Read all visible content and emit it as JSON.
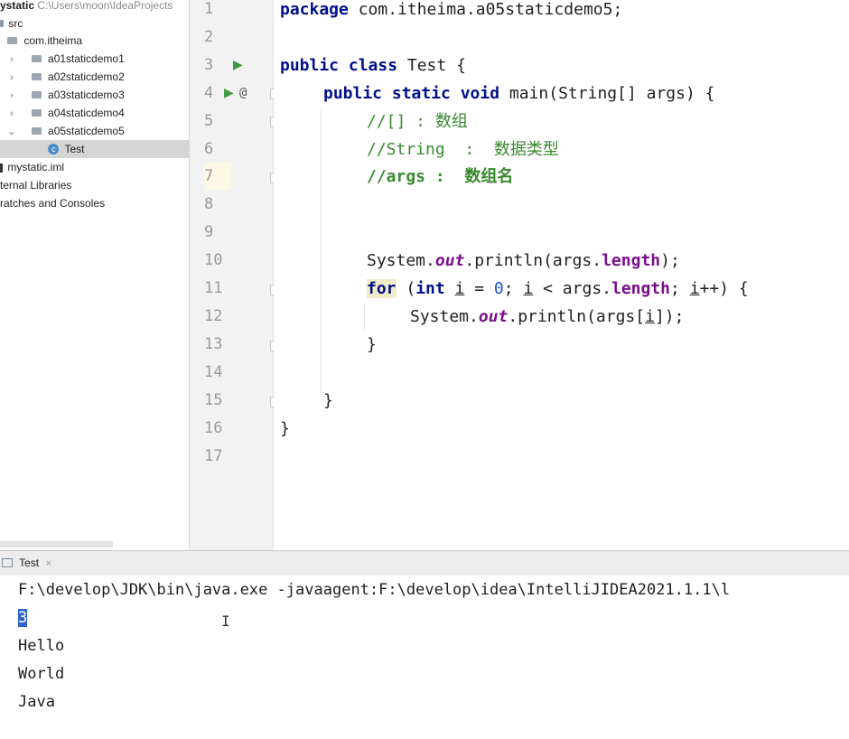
{
  "project_tree": {
    "root_label": "ystatic",
    "root_path": "C:\\Users\\moon\\IdeaProjects",
    "items": [
      {
        "label": "src",
        "icon": "folder-icon"
      },
      {
        "label": "com.itheima",
        "icon": "package-folder-icon"
      },
      {
        "label": "a01staticdemo1",
        "icon": "package-folder-icon"
      },
      {
        "label": "a02staticdemo2",
        "icon": "package-folder-icon"
      },
      {
        "label": "a03staticdemo3",
        "icon": "package-folder-icon"
      },
      {
        "label": "a04staticdemo4",
        "icon": "package-folder-icon"
      },
      {
        "label": "a05staticdemo5",
        "icon": "package-folder-icon"
      },
      {
        "label": "Test",
        "icon": "class-icon"
      },
      {
        "label": "mystatic.iml",
        "icon": "module-file-icon"
      },
      {
        "label": "ternal Libraries",
        "icon": "library-icon"
      },
      {
        "label": "ratches and Consoles",
        "icon": "scratch-icon"
      }
    ]
  },
  "editor": {
    "line_numbers": [
      "1",
      "2",
      "3",
      "4",
      "5",
      "6",
      "7",
      "8",
      "9",
      "10",
      "11",
      "12",
      "13",
      "14",
      "15",
      "16",
      "17"
    ],
    "lines": {
      "l1_kw": "package",
      "l1_rest": " com.itheima.a05staticdemo5;",
      "l3_kw": "public class",
      "l3_rest": " Test {",
      "l4_kw": "public static void",
      "l4_rest": " main(String[] args) {",
      "l5": "//[] : 数组",
      "l6": "//String  :  数据类型",
      "l7": "//args :  数组名",
      "l10_a": "System.",
      "l10_out": "out",
      "l10_b": ".println(args.",
      "l10_len": "length",
      "l10_c": ");",
      "l11_for": "for",
      "l11_a": " (",
      "l11_int": "int",
      "l11_sp": " ",
      "l11_i1": "i",
      "l11_eq": " = ",
      "l11_zero": "0",
      "l11_sc": "; ",
      "l11_i2": "i",
      "l11_lt": " < args.",
      "l11_len": "length",
      "l11_sc2": "; ",
      "l11_i3": "i",
      "l11_end": "++) {",
      "l12_a": "System.",
      "l12_out": "out",
      "l12_b": ".println(args[",
      "l12_i": "i",
      "l12_c": "]);",
      "l13": "}",
      "l15": "}",
      "l16": "}"
    }
  },
  "run_window": {
    "tab_label": "Test",
    "close_label": "×",
    "command_line": "F:\\develop\\JDK\\bin\\java.exe -javaagent:F:\\develop\\idea\\IntelliJIDEA2021.1.1\\l",
    "output": [
      "3",
      "Hello",
      "World",
      "Java"
    ]
  },
  "colors": {
    "keyword": "#00108a",
    "comment": "#398a2f",
    "field": "#7a0f8c",
    "number": "#1b50d3",
    "caret_line": "#fdf8e6",
    "selection": "#2f65ca"
  }
}
